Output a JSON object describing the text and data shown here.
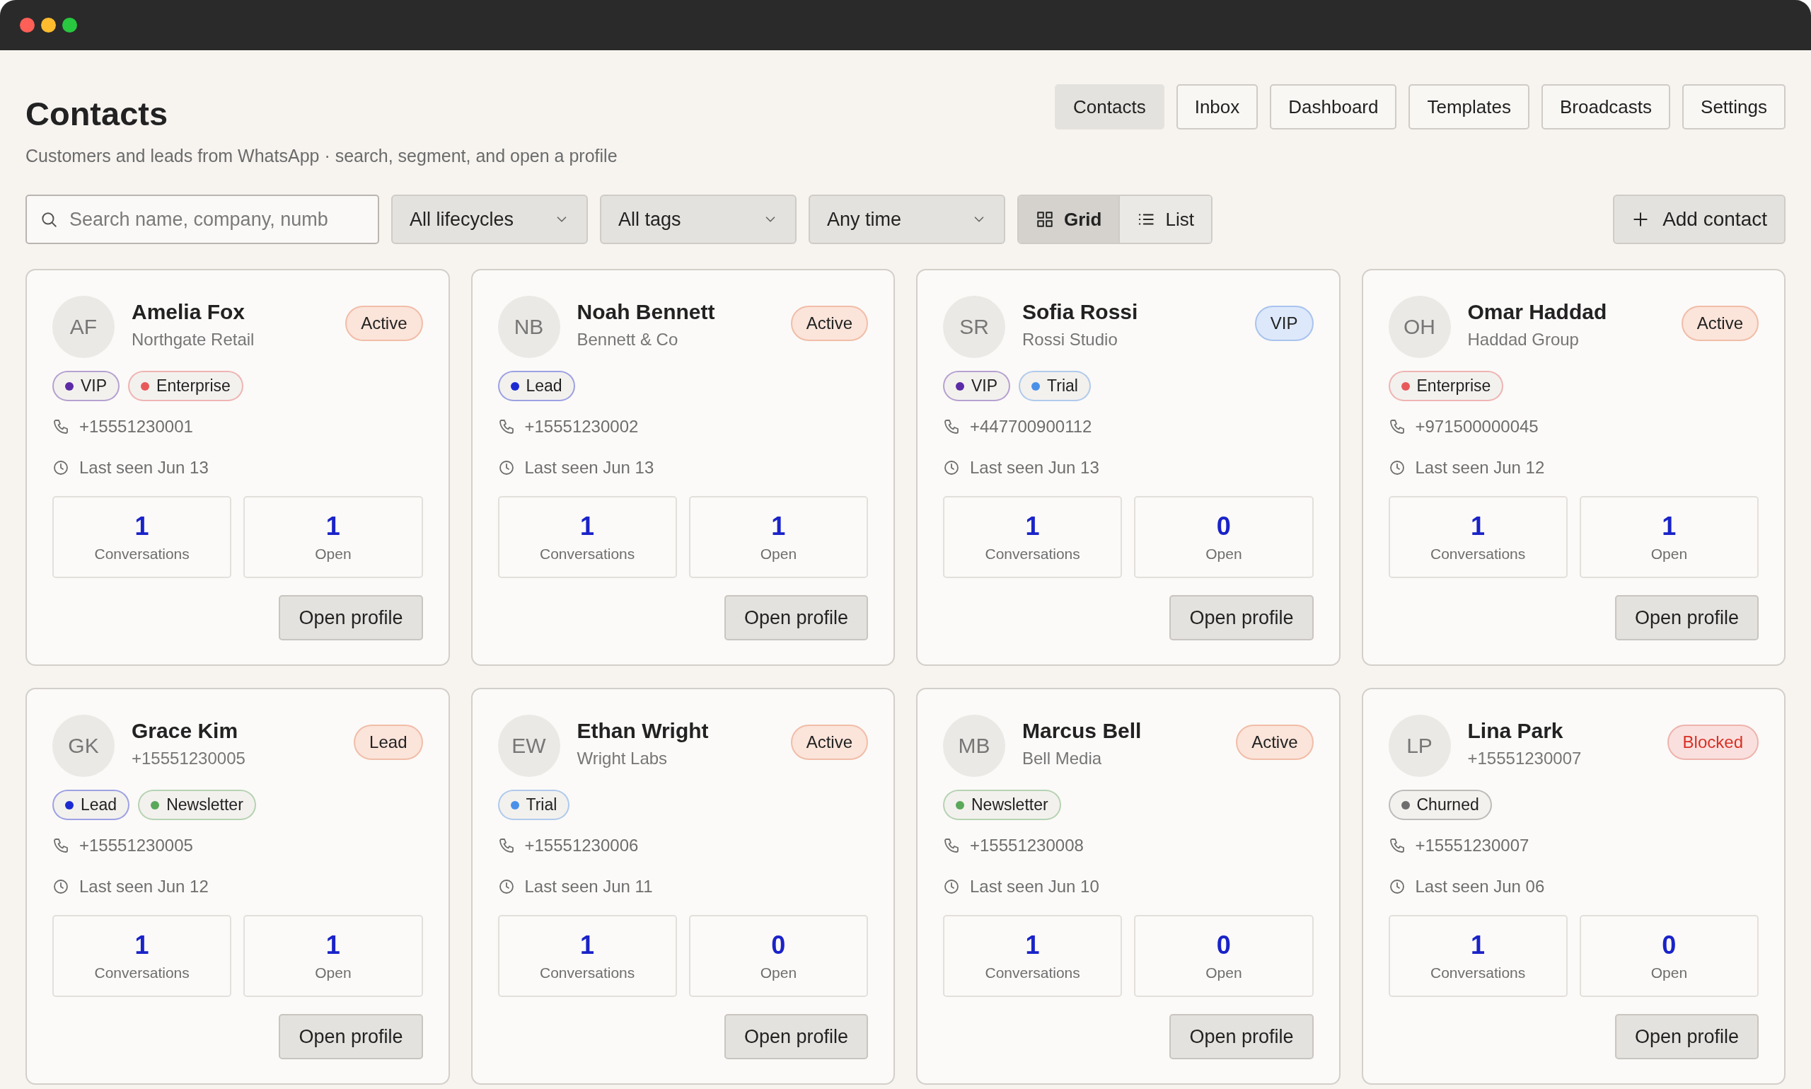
{
  "window": {
    "controls": [
      {
        "color": "#fe5f57"
      },
      {
        "color": "#febc2e"
      },
      {
        "color": "#28c840"
      }
    ]
  },
  "header": {
    "title": "Contacts",
    "subtitle": "Customers and leads from WhatsApp · search, segment, and open a profile"
  },
  "nav": [
    {
      "label": "Contacts",
      "selected": true
    },
    {
      "label": "Inbox",
      "selected": false
    },
    {
      "label": "Dashboard",
      "selected": false
    },
    {
      "label": "Templates",
      "selected": false
    },
    {
      "label": "Broadcasts",
      "selected": false
    },
    {
      "label": "Settings",
      "selected": false
    }
  ],
  "toolbar": {
    "search": {
      "placeholder": "Search name, company, numb"
    },
    "filters": [
      {
        "value": "All lifecycles"
      },
      {
        "value": "All tags"
      },
      {
        "value": "Any time"
      }
    ],
    "view_toggle": [
      {
        "kind": "grid",
        "label": "Grid",
        "selected": true
      },
      {
        "kind": "list",
        "label": "List",
        "selected": false
      }
    ],
    "add_button": "Add contact"
  },
  "contacts": [
    {
      "initials": "AF",
      "name": "Amelia Fox",
      "subtitle": "Northgate Retail",
      "status": {
        "label": "Active",
        "kind": "warm"
      },
      "tags": [
        {
          "label": "VIP",
          "color": "#5b2ba6"
        },
        {
          "label": "Enterprise",
          "color": "#e85a5a"
        }
      ],
      "phone": "+15551230001",
      "last_seen": "Last seen Jun 13",
      "stats": [
        {
          "value": "1",
          "label": "Conversations"
        },
        {
          "value": "1",
          "label": "Open"
        }
      ],
      "action": "Open profile"
    },
    {
      "initials": "NB",
      "name": "Noah Bennett",
      "subtitle": "Bennett & Co",
      "status": {
        "label": "Active",
        "kind": "warm"
      },
      "tags": [
        {
          "label": "Lead",
          "color": "#1c2bd1"
        }
      ],
      "phone": "+15551230002",
      "last_seen": "Last seen Jun 13",
      "stats": [
        {
          "value": "1",
          "label": "Conversations"
        },
        {
          "value": "1",
          "label": "Open"
        }
      ],
      "action": "Open profile"
    },
    {
      "initials": "SR",
      "name": "Sofia Rossi",
      "subtitle": "Rossi Studio",
      "status": {
        "label": "VIP",
        "kind": "info"
      },
      "tags": [
        {
          "label": "VIP",
          "color": "#5b2ba6"
        },
        {
          "label": "Trial",
          "color": "#4a90e8"
        }
      ],
      "phone": "+447700900112",
      "last_seen": "Last seen Jun 13",
      "stats": [
        {
          "value": "1",
          "label": "Conversations"
        },
        {
          "value": "0",
          "label": "Open"
        }
      ],
      "action": "Open profile"
    },
    {
      "initials": "OH",
      "name": "Omar Haddad",
      "subtitle": "Haddad Group",
      "status": {
        "label": "Active",
        "kind": "warm"
      },
      "tags": [
        {
          "label": "Enterprise",
          "color": "#e85a5a"
        }
      ],
      "phone": "+971500000045",
      "last_seen": "Last seen Jun 12",
      "stats": [
        {
          "value": "1",
          "label": "Conversations"
        },
        {
          "value": "1",
          "label": "Open"
        }
      ],
      "action": "Open profile"
    },
    {
      "initials": "GK",
      "name": "Grace Kim",
      "subtitle": "+15551230005",
      "status": {
        "label": "Lead",
        "kind": "warm"
      },
      "tags": [
        {
          "label": "Lead",
          "color": "#1c2bd1"
        },
        {
          "label": "Newsletter",
          "color": "#5aa85a"
        }
      ],
      "phone": "+15551230005",
      "last_seen": "Last seen Jun 12",
      "stats": [
        {
          "value": "1",
          "label": "Conversations"
        },
        {
          "value": "1",
          "label": "Open"
        }
      ],
      "action": "Open profile"
    },
    {
      "initials": "EW",
      "name": "Ethan Wright",
      "subtitle": "Wright Labs",
      "status": {
        "label": "Active",
        "kind": "warm"
      },
      "tags": [
        {
          "label": "Trial",
          "color": "#4a90e8"
        }
      ],
      "phone": "+15551230006",
      "last_seen": "Last seen Jun 11",
      "stats": [
        {
          "value": "1",
          "label": "Conversations"
        },
        {
          "value": "0",
          "label": "Open"
        }
      ],
      "action": "Open profile"
    },
    {
      "initials": "MB",
      "name": "Marcus Bell",
      "subtitle": "Bell Media",
      "status": {
        "label": "Active",
        "kind": "warm"
      },
      "tags": [
        {
          "label": "Newsletter",
          "color": "#5aa85a"
        }
      ],
      "phone": "+15551230008",
      "last_seen": "Last seen Jun 10",
      "stats": [
        {
          "value": "1",
          "label": "Conversations"
        },
        {
          "value": "0",
          "label": "Open"
        }
      ],
      "action": "Open profile"
    },
    {
      "initials": "LP",
      "name": "Lina Park",
      "subtitle": "+15551230007",
      "status": {
        "label": "Blocked",
        "kind": "danger"
      },
      "tags": [
        {
          "label": "Churned",
          "color": "#6e6e6e"
        }
      ],
      "phone": "+15551230007",
      "last_seen": "Last seen Jun 06",
      "stats": [
        {
          "value": "1",
          "label": "Conversations"
        },
        {
          "value": "0",
          "label": "Open"
        }
      ],
      "action": "Open profile"
    }
  ]
}
